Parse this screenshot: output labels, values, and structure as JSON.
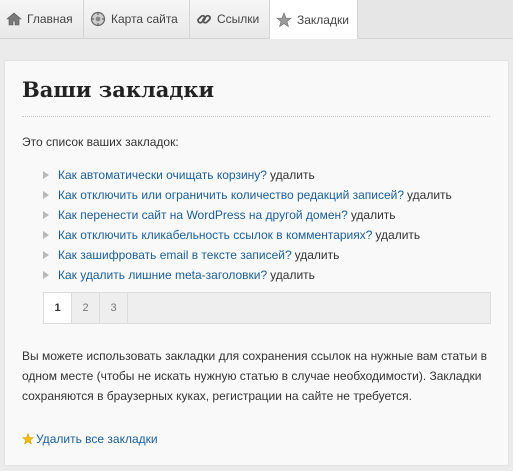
{
  "tabs": [
    {
      "label": "Главная",
      "icon": "home-icon",
      "active": false
    },
    {
      "label": "Карта сайта",
      "icon": "sitemap-icon",
      "active": false
    },
    {
      "label": "Ссылки",
      "icon": "link-icon",
      "active": false
    },
    {
      "label": "Закладки",
      "icon": "star-icon",
      "active": true
    }
  ],
  "main": {
    "title": "Ваши закладки",
    "intro": "Это список ваших закладок:",
    "delete_label": "удалить",
    "bookmarks": [
      {
        "title": "Как автоматически очищать корзину?"
      },
      {
        "title": "Как отключить или ограничить количество редакций записей?"
      },
      {
        "title": "Как перенести сайт на WordPress на другой домен?"
      },
      {
        "title": "Как отключить кликабельность ссылок в комментариях?"
      },
      {
        "title": "Как зашифровать email в тексте записей?"
      },
      {
        "title": "Как удалить лишние meta-заголовки?"
      }
    ],
    "pagination": {
      "pages": [
        "1",
        "2",
        "3"
      ],
      "current": "1"
    },
    "note": "Вы можете использовать закладки для сохранения ссылок на нужные вам статьи в одном месте (чтобы не искать нужную статью в случае необходимости). Закладки сохраняются в браузерных куках, регистрации на сайте не требуется.",
    "delete_all_label": "Удалить все закладки",
    "delete_all_icon": "star-icon"
  },
  "colors": {
    "link": "#1a5e97",
    "background": "#ebebeb",
    "panel": "#f9f9f9",
    "star": "#f2c200"
  }
}
